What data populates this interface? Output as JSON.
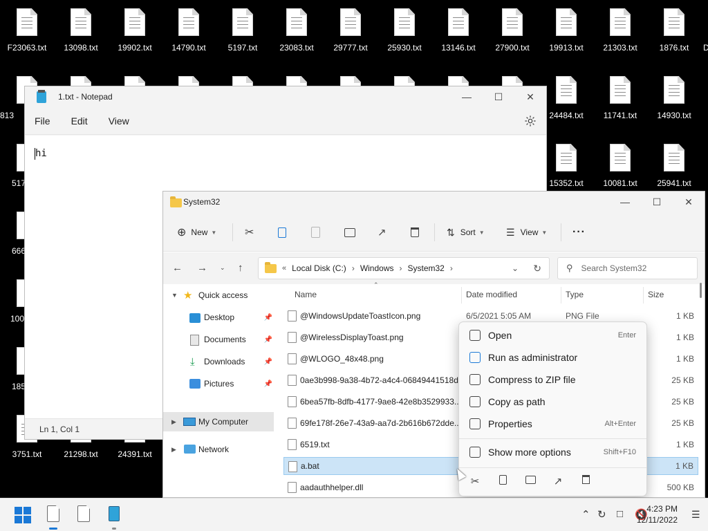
{
  "desktop": {
    "icons_row1": [
      "F23063.txt",
      "13098.txt",
      "19902.txt",
      "14790.txt",
      "5197.txt",
      "23083.txt",
      "29777.txt",
      "25930.txt",
      "13146.txt",
      "27900.txt",
      "19913.txt",
      "21303.txt",
      "1876.txt",
      "D"
    ],
    "icons_row2_right": [
      "24484.txt",
      "11741.txt",
      "14930.txt"
    ],
    "icons_row3_right": [
      "15352.txt",
      "10081.txt",
      "25941.txt"
    ],
    "left_partial": [
      "813",
      "517",
      "666",
      "100",
      "185"
    ],
    "icons_bottom": [
      "3751.txt",
      "21298.txt",
      "24391.txt"
    ]
  },
  "notepad": {
    "title": "1.txt - Notepad",
    "menu": [
      "File",
      "Edit",
      "View"
    ],
    "content": "hi",
    "status": "Ln 1, Col 1"
  },
  "explorer": {
    "title": "System32",
    "toolbar": {
      "new_label": "New",
      "sort_label": "Sort",
      "view_label": "View",
      "more_label": "···"
    },
    "breadcrumb": [
      "Local Disk (C:)",
      "Windows",
      "System32"
    ],
    "search_placeholder": "Search System32",
    "nav": {
      "quick_access": "Quick access",
      "desktop": "Desktop",
      "documents": "Documents",
      "downloads": "Downloads",
      "pictures": "Pictures",
      "my_computer": "My Computer",
      "network": "Network"
    },
    "columns": {
      "name": "Name",
      "date": "Date modified",
      "type": "Type",
      "size": "Size"
    },
    "files": [
      {
        "name": "@WindowsUpdateToastIcon.png",
        "date": "6/5/2021 5:05 AM",
        "type": "PNG File",
        "size": "1 KB"
      },
      {
        "name": "@WirelessDisplayToast.png",
        "date": "",
        "type": "",
        "size": "1 KB"
      },
      {
        "name": "@WLOGO_48x48.png",
        "date": "",
        "type": "",
        "size": "1 KB"
      },
      {
        "name": "0ae3b998-9a38-4b72-a4c4-06849441518d...",
        "date": "",
        "type": "",
        "size": "25 KB"
      },
      {
        "name": "6bea57fb-8dfb-4177-9ae8-42e8b3529933...",
        "date": "",
        "type": "",
        "size": "25 KB"
      },
      {
        "name": "69fe178f-26e7-43a9-aa7d-2b616b672dde...",
        "date": "",
        "type": "",
        "size": "25 KB"
      },
      {
        "name": "6519.txt",
        "date": "",
        "type": "",
        "size": "1 KB"
      },
      {
        "name": "a.bat",
        "date": "",
        "type": "",
        "size": "1 KB"
      },
      {
        "name": "aadauthhelper.dll",
        "date": "",
        "type": "",
        "size": "500 KB"
      }
    ]
  },
  "context_menu": {
    "items": [
      {
        "label": "Open",
        "key": "Enter"
      },
      {
        "label": "Run as administrator",
        "key": ""
      },
      {
        "label": "Compress to ZIP file",
        "key": ""
      },
      {
        "label": "Copy as path",
        "key": ""
      },
      {
        "label": "Properties",
        "key": "Alt+Enter"
      }
    ],
    "more": {
      "label": "Show more options",
      "key": "Shift+F10"
    }
  },
  "taskbar": {
    "time": "4:23 PM",
    "date": "12/11/2022"
  },
  "colors": {
    "accent": "#1a78d6",
    "selection": "#cce4f7",
    "folder": "#f5c749"
  }
}
